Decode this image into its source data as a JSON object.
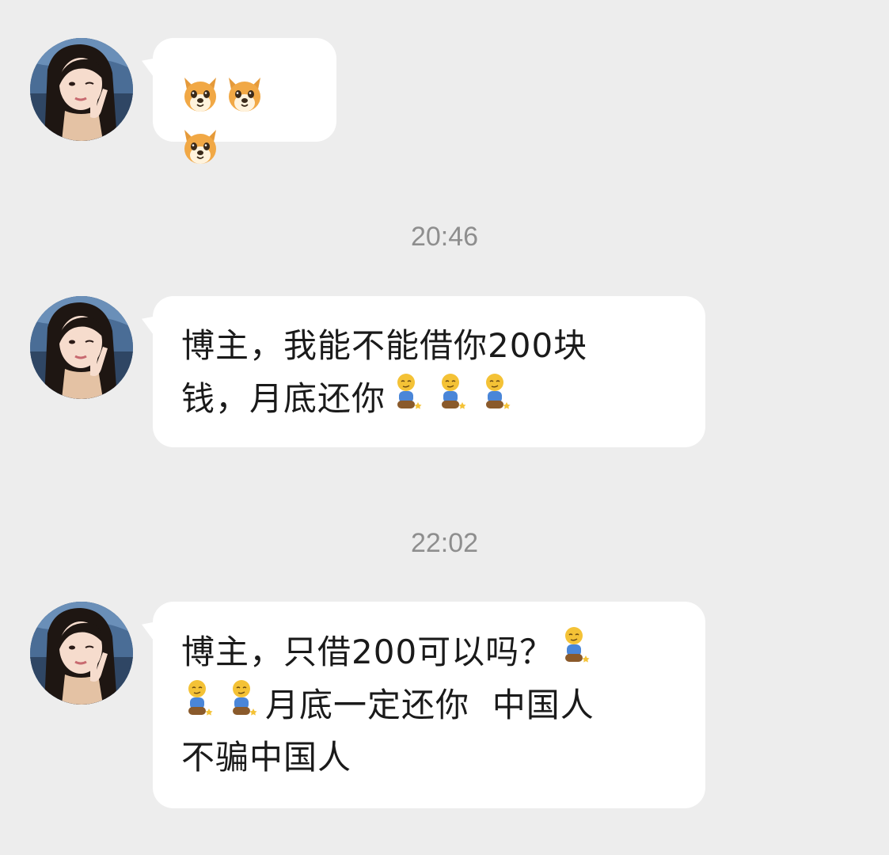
{
  "messages": [
    {
      "type": "emoji",
      "emojis": [
        "dog-face-icon",
        "dog-face-icon",
        "dog-face-icon"
      ]
    },
    {
      "type": "text",
      "line1": "博主，我能不能借你200块",
      "line2_text": "钱，月底还你",
      "emojis": [
        "kneeling-person-icon",
        "kneeling-person-icon",
        "kneeling-person-icon"
      ]
    },
    {
      "type": "text",
      "line1_text": "博主，只借200可以吗？",
      "line2_text": "月底一定还你  中国人",
      "line3": "不骗中国人"
    }
  ],
  "timestamps": [
    "20:46",
    "22:02"
  ],
  "colors": {
    "background": "#ededed",
    "bubble": "#ffffff",
    "text": "#1a1a1a",
    "timestamp": "#8e8e8e"
  }
}
